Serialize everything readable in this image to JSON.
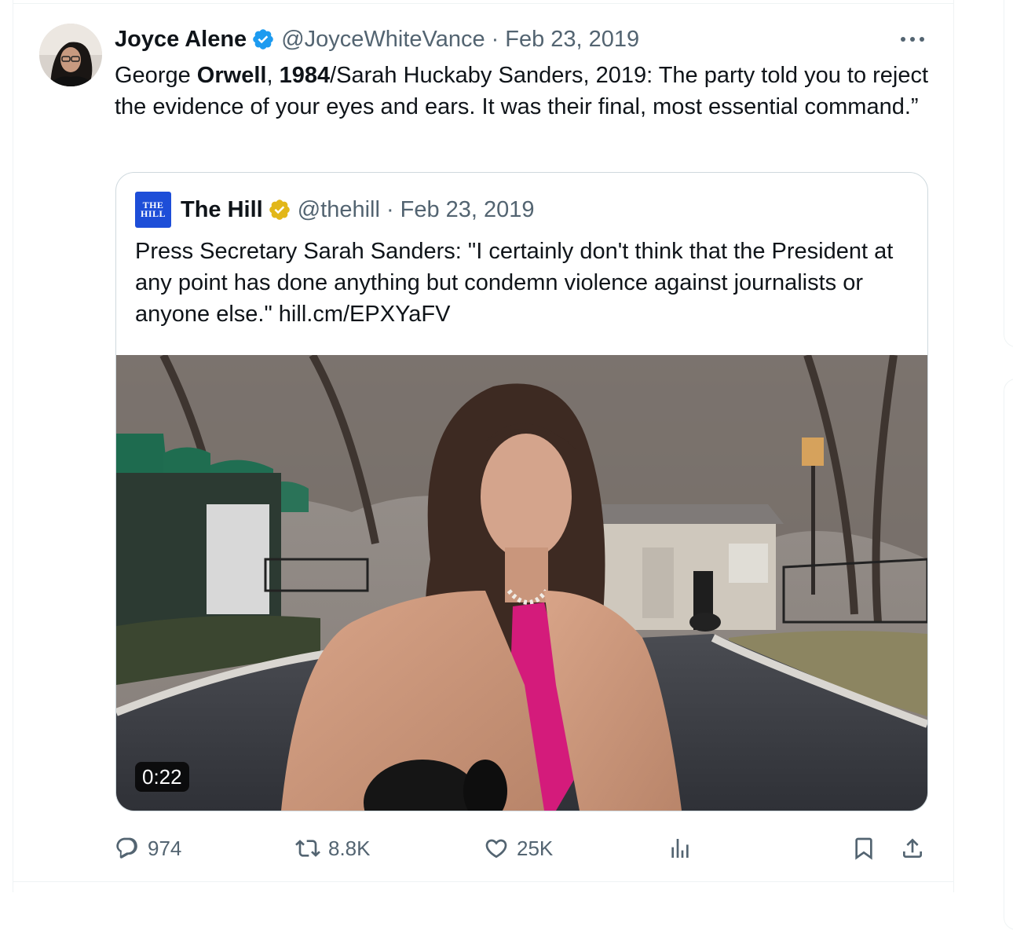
{
  "tweet": {
    "author_name": "Joyce Alene",
    "handle": "@JoyceWhiteVance",
    "separator": "·",
    "date": "Feb 23, 2019",
    "text_parts": [
      "George ",
      "Orwell",
      ", ",
      "1984",
      "/Sarah Huckaby Sanders, 2019: The party told you to reject the evidence of your eyes and ears. It was their final, most essential command.”"
    ],
    "avatar_icon": "person-avatar-icon",
    "verified_color": "#1d9bf0"
  },
  "quote": {
    "logo_lines": [
      "THE",
      "HILL"
    ],
    "author_name": "The Hill",
    "handle": "@thehill",
    "separator": "·",
    "date": "Feb 23, 2019",
    "text": "Press Secretary Sarah Sanders: \"I certainly don't think that the President at any point has done anything but condemn violence against journalists or anyone else.\" hill.cm/EPXYaFV",
    "video_duration": "0:22",
    "verified_color": "#e2b719"
  },
  "actions": {
    "replies": "974",
    "reposts": "8.8K",
    "likes": "25K"
  },
  "colors": {
    "text": "#0f1419",
    "muted": "#536471",
    "border": "#cfd9de"
  }
}
